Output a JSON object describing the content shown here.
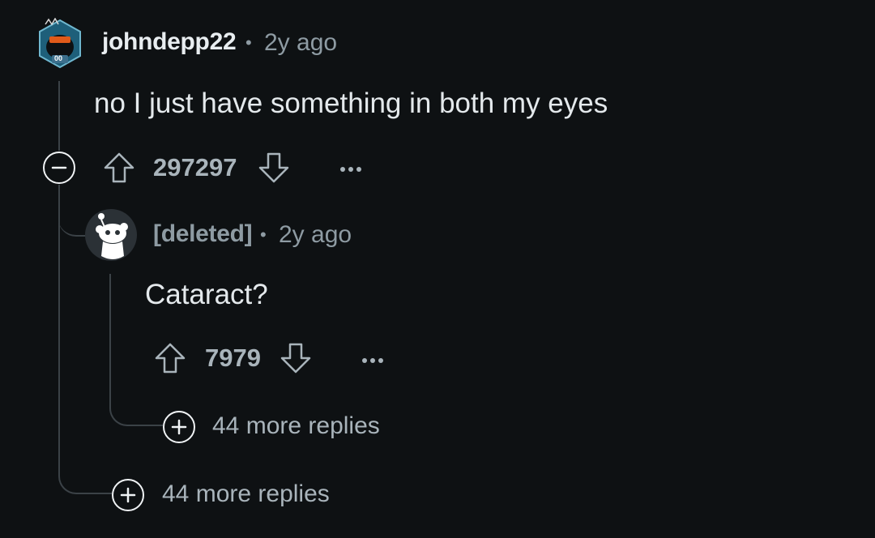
{
  "root_comment": {
    "username": "johndepp22",
    "separator": "•",
    "time": "2y ago",
    "body": "no I just have something in both my eyes",
    "score": "297297",
    "avatar_icon": "snoo-avatar-icon",
    "avatar_badge": "00"
  },
  "reply": {
    "username": "[deleted]",
    "separator": "•",
    "time": "2y ago",
    "body": "Cataract?",
    "score": "7979",
    "avatar_icon": "reddit-snoo-icon"
  },
  "nested_more_replies": "44 more replies",
  "root_more_replies": "44 more replies",
  "colors": {
    "background": "#0e1113",
    "thread_line": "#3b4247",
    "secondary_text": "#8e9ba3",
    "score_text": "#a9b4bb"
  }
}
